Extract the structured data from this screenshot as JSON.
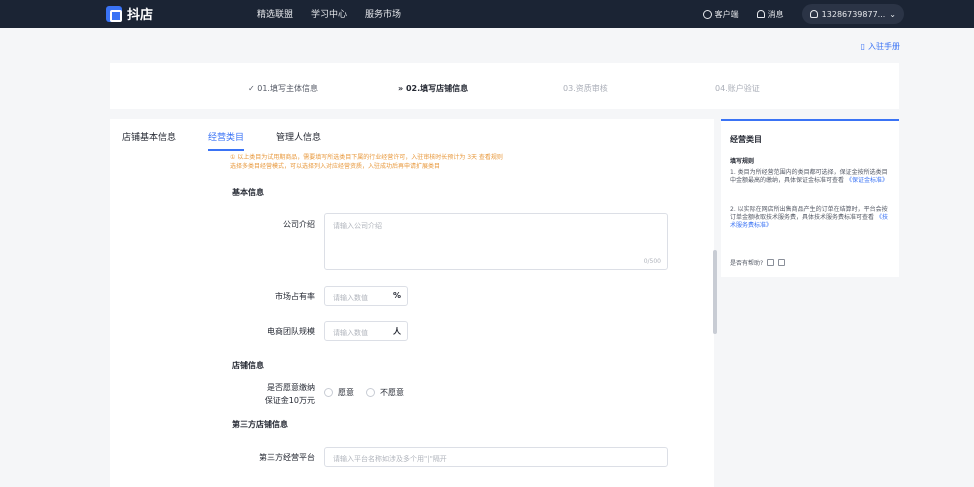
{
  "app": {
    "logo_text": "抖店"
  },
  "nav": {
    "items": [
      "精选联盟",
      "学习中心",
      "服务市场"
    ]
  },
  "topbar": {
    "client_label": "客户端",
    "message_label": "消息",
    "user_label": "13286739877..."
  },
  "help": {
    "guide_label": "入驻手册"
  },
  "steps": [
    {
      "label": "✓ 01.填写主体信息",
      "state": "done"
    },
    {
      "label": "» 02.填写店铺信息",
      "state": "active"
    },
    {
      "label": "03.资质审核",
      "state": "todo"
    },
    {
      "label": "04.账户验证",
      "state": "todo"
    }
  ],
  "tabs": [
    {
      "label": "店铺基本信息",
      "active": false
    },
    {
      "label": "经营类目",
      "active": true
    },
    {
      "label": "管理人信息",
      "active": false
    }
  ],
  "notice": {
    "line1": "① 以上类目为试用期商品，需要填写所选类目下属的行业经营许可，入驻审核时长预计为 3天  查看规则",
    "line2": "选择多类目经营模式，可以选择列入对应经营资质，入驻成功后再申请扩展类目"
  },
  "form": {
    "basic_title": "基本信息",
    "company_intro_label": "公司介绍",
    "company_intro_placeholder": "请输入公司介绍",
    "company_intro_counter": "0/500",
    "market_share_label": "市场占有率",
    "market_share_placeholder": "请输入数值",
    "market_share_suffix": "%",
    "team_size_label": "电商团队规模",
    "team_size_placeholder": "请输入数值",
    "team_size_suffix": "人",
    "shop_title": "店铺信息",
    "deposit_label_line1": "是否愿意缴纳",
    "deposit_label_line2": "保证金10万元",
    "deposit_options": [
      "愿意",
      "不愿意"
    ],
    "third_party_title": "第三方店铺信息",
    "third_party_label": "第三方经营平台",
    "third_party_placeholder": "请输入平台名称如涉及多个用\"|\"隔开"
  },
  "side": {
    "title": "经营类目",
    "rules_title": "填写规则",
    "rule1_text": "1. 类目为所经营范围内的类目都可选择，保证金按所选类目中金额最高的缴纳，具体保证金标准可查看",
    "rule1_link": "《保证金标准》",
    "rule2_text": "2. 以实际在网店所出售商品产生的订单在结算时，平台会按订单金额收取技术服务费，具体技术服务费标准可查看",
    "rule2_link": "《技术服务费标准》",
    "feedback_label": "是否有帮助?"
  }
}
